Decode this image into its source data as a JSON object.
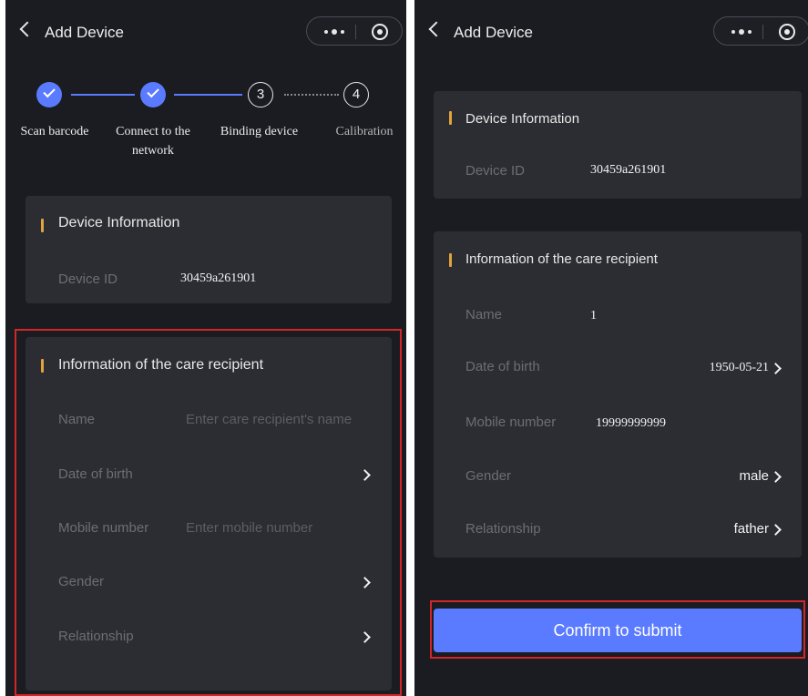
{
  "left": {
    "header": {
      "title": "Add Device"
    },
    "steps": [
      {
        "number": "",
        "label": "Scan barcode",
        "state": "done"
      },
      {
        "number": "",
        "label": "Connect to the network",
        "state": "done"
      },
      {
        "number": "3",
        "label": "Binding device",
        "state": "current"
      },
      {
        "number": "4",
        "label": "Calibration",
        "state": "upcoming"
      }
    ],
    "device_card": {
      "title": "Device Information",
      "device_id_label": "Device ID",
      "device_id_value": "30459a261901"
    },
    "recipient_card": {
      "title": "Information of the care recipient",
      "name_label": "Name",
      "name_placeholder": "Enter care recipient's name",
      "dob_label": "Date of birth",
      "mobile_label": "Mobile number",
      "mobile_placeholder": "Enter mobile number",
      "gender_label": "Gender",
      "relationship_label": "Relationship"
    }
  },
  "right": {
    "header": {
      "title": "Add Device"
    },
    "device_card": {
      "title": "Device Information",
      "device_id_label": "Device ID",
      "device_id_value": "30459a261901"
    },
    "recipient_card": {
      "title": "Information of the care recipient",
      "name_label": "Name",
      "name_value": "1",
      "dob_label": "Date of birth",
      "dob_value": "1950-05-21",
      "mobile_label": "Mobile number",
      "mobile_value": "19999999999",
      "gender_label": "Gender",
      "gender_value": "male",
      "relationship_label": "Relationship",
      "relationship_value": "father"
    },
    "submit_label": "Confirm to submit"
  },
  "icons": [
    "back-chevron-icon",
    "more-icon",
    "target-icon",
    "check-icon",
    "chevron-right-icon"
  ],
  "colors": {
    "background": "#1a1c21",
    "card": "#2c2d33",
    "accent": "#e2a23c",
    "primary": "#5a7bff",
    "highlight": "#d2262b"
  }
}
